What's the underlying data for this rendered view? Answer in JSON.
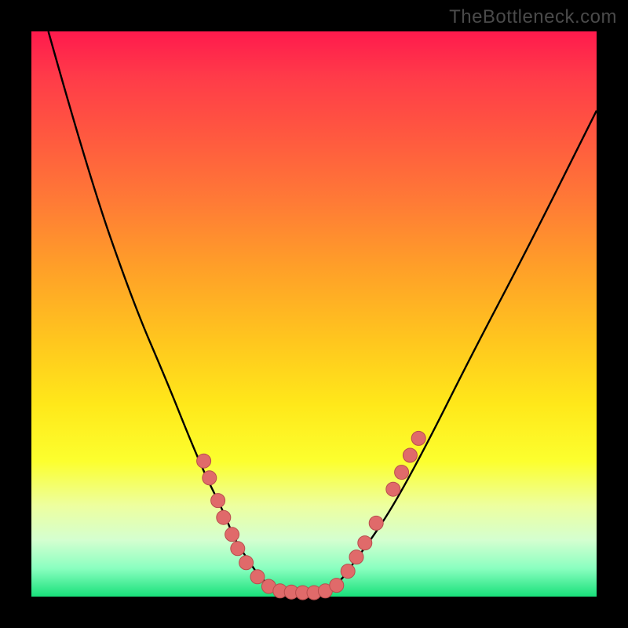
{
  "watermark": "TheBottleneck.com",
  "colors": {
    "background": "#000000",
    "curve": "#000000",
    "marker_fill": "#e06a6a",
    "marker_stroke": "#b84d4d",
    "gradient_top": "#ff1a4d",
    "gradient_bottom": "#18e07a"
  },
  "chart_data": {
    "type": "line",
    "title": "",
    "xlabel": "",
    "ylabel": "",
    "xlim": [
      0,
      100
    ],
    "ylim": [
      0,
      100
    ],
    "note": "Axis units are percentage of plot width/height; y measured from top (0) to bottom (100).",
    "series": [
      {
        "name": "bottleneck-curve",
        "x": [
          3,
          10,
          18,
          24,
          28,
          31,
          34,
          36,
          38,
          40,
          42,
          44,
          48,
          52,
          55,
          57,
          60,
          64,
          70,
          78,
          88,
          100
        ],
        "y": [
          0,
          25,
          48,
          62,
          72,
          79,
          85,
          90,
          93,
          96,
          98,
          99,
          99,
          99,
          97,
          94,
          90,
          84,
          73,
          57,
          38,
          14
        ]
      }
    ],
    "markers": {
      "name": "data-points",
      "points": [
        {
          "x": 30.5,
          "y": 76
        },
        {
          "x": 31.5,
          "y": 79
        },
        {
          "x": 33.0,
          "y": 83
        },
        {
          "x": 34.0,
          "y": 86
        },
        {
          "x": 35.5,
          "y": 89
        },
        {
          "x": 36.5,
          "y": 91.5
        },
        {
          "x": 38.0,
          "y": 94
        },
        {
          "x": 40.0,
          "y": 96.5
        },
        {
          "x": 42.0,
          "y": 98.2
        },
        {
          "x": 44.0,
          "y": 99.0
        },
        {
          "x": 46.0,
          "y": 99.2
        },
        {
          "x": 48.0,
          "y": 99.3
        },
        {
          "x": 50.0,
          "y": 99.3
        },
        {
          "x": 52.0,
          "y": 99.0
        },
        {
          "x": 54.0,
          "y": 98.0
        },
        {
          "x": 56.0,
          "y": 95.5
        },
        {
          "x": 57.5,
          "y": 93
        },
        {
          "x": 59.0,
          "y": 90.5
        },
        {
          "x": 61.0,
          "y": 87
        },
        {
          "x": 64.0,
          "y": 81
        },
        {
          "x": 65.5,
          "y": 78
        },
        {
          "x": 67.0,
          "y": 75
        },
        {
          "x": 68.5,
          "y": 72
        }
      ]
    }
  }
}
